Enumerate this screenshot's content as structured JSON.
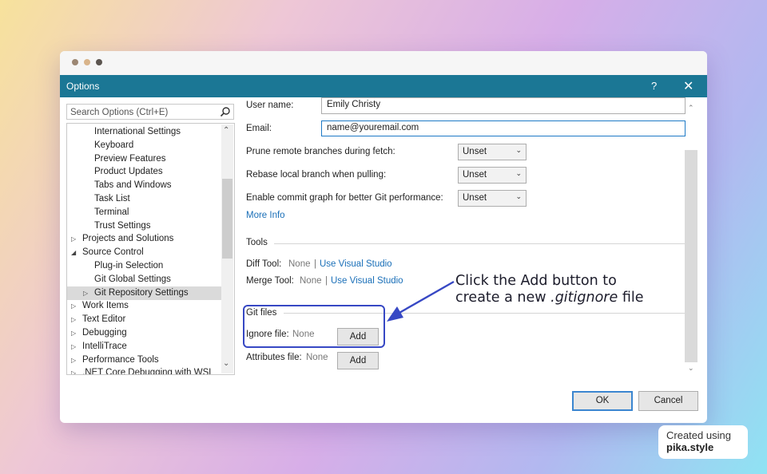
{
  "window": {
    "title": "Options",
    "help_icon": "?",
    "close_icon": "✕",
    "dot_colors": [
      "#9c8773",
      "#d9b48a",
      "#5c5550"
    ]
  },
  "search": {
    "placeholder": "Search Options (Ctrl+E)"
  },
  "tree": {
    "items": [
      {
        "label": "International Settings",
        "level": 2,
        "expander": "",
        "selected": false
      },
      {
        "label": "Keyboard",
        "level": 2,
        "expander": "",
        "selected": false
      },
      {
        "label": "Preview Features",
        "level": 2,
        "expander": "",
        "selected": false
      },
      {
        "label": "Product Updates",
        "level": 2,
        "expander": "",
        "selected": false
      },
      {
        "label": "Tabs and Windows",
        "level": 2,
        "expander": "",
        "selected": false
      },
      {
        "label": "Task List",
        "level": 2,
        "expander": "",
        "selected": false
      },
      {
        "label": "Terminal",
        "level": 2,
        "expander": "",
        "selected": false
      },
      {
        "label": "Trust Settings",
        "level": 2,
        "expander": "",
        "selected": false
      },
      {
        "label": "Projects and Solutions",
        "level": 1,
        "expander": "collapsed",
        "selected": false
      },
      {
        "label": "Source Control",
        "level": 1,
        "expander": "expanded",
        "selected": false
      },
      {
        "label": "Plug-in Selection",
        "level": 2,
        "expander": "",
        "selected": false
      },
      {
        "label": "Git Global Settings",
        "level": 2,
        "expander": "",
        "selected": false
      },
      {
        "label": "Git Repository Settings",
        "level": 2,
        "expander": "collapsed",
        "selected": true
      },
      {
        "label": "Work Items",
        "level": 1,
        "expander": "collapsed",
        "selected": false
      },
      {
        "label": "Text Editor",
        "level": 1,
        "expander": "collapsed",
        "selected": false
      },
      {
        "label": "Debugging",
        "level": 1,
        "expander": "collapsed",
        "selected": false
      },
      {
        "label": "IntelliTrace",
        "level": 1,
        "expander": "collapsed",
        "selected": false
      },
      {
        "label": "Performance Tools",
        "level": 1,
        "expander": "collapsed",
        "selected": false
      },
      {
        "label": ".NET Core Debugging with WSL",
        "level": 1,
        "expander": "collapsed",
        "selected": false
      }
    ]
  },
  "settings": {
    "user_name_label": "User name:",
    "user_name_value": "Emily Christy",
    "email_label": "Email:",
    "email_value": "name@youremail.com",
    "prune_label": "Prune remote branches during fetch:",
    "prune_value": "Unset",
    "rebase_label": "Rebase local branch when pulling:",
    "rebase_value": "Unset",
    "commit_graph_label": "Enable commit graph for better Git performance:",
    "commit_graph_value": "Unset",
    "more_info": "More Info"
  },
  "tools": {
    "section": "Tools",
    "diff_label": "Diff Tool:",
    "diff_value": "None",
    "diff_link": "Use Visual Studio",
    "merge_label": "Merge Tool:",
    "merge_value": "None",
    "merge_link": "Use Visual Studio",
    "separator": "|"
  },
  "git_files": {
    "section": "Git files",
    "ignore_label": "Ignore file:",
    "ignore_value": "None",
    "ignore_button": "Add",
    "attributes_label": "Attributes file:",
    "attributes_value": "None",
    "attributes_button": "Add"
  },
  "footer": {
    "ok": "OK",
    "cancel": "Cancel"
  },
  "annotation": {
    "line1": "Click the Add button to",
    "line2_prefix": "create a new ",
    "line2_italic": ".gitignore",
    "line2_suffix": " file",
    "color": "#3748c4"
  },
  "watermark": {
    "line1": "Created using",
    "line2": "pika.style"
  }
}
